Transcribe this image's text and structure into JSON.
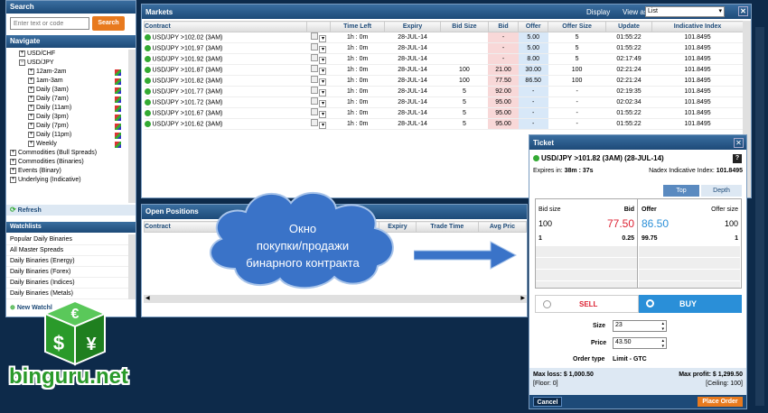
{
  "left": {
    "search_title": "Search",
    "search_placeholder": "Enter text or code",
    "search_button": "Search",
    "navigate_title": "Navigate",
    "tree": [
      {
        "label": "USD/CHF",
        "level": 1,
        "toggle": "+"
      },
      {
        "label": "USD/JPY",
        "level": 1,
        "toggle": "−"
      },
      {
        "label": "12am-2am",
        "level": 2,
        "toggle": "+"
      },
      {
        "label": "1am-3am",
        "level": 2,
        "toggle": "+"
      },
      {
        "label": "Daily (3am)",
        "level": 2,
        "toggle": "+"
      },
      {
        "label": "Daily (7am)",
        "level": 2,
        "toggle": "+"
      },
      {
        "label": "Daily (11am)",
        "level": 2,
        "toggle": "+"
      },
      {
        "label": "Daily (3pm)",
        "level": 2,
        "toggle": "+"
      },
      {
        "label": "Daily (7pm)",
        "level": 2,
        "toggle": "+"
      },
      {
        "label": "Daily (11pm)",
        "level": 2,
        "toggle": "+"
      },
      {
        "label": "Weekly",
        "level": 2,
        "toggle": "+"
      },
      {
        "label": "Commodities (Bull Spreads)",
        "level": 0,
        "toggle": "+"
      },
      {
        "label": "Commodities (Binaries)",
        "level": 0,
        "toggle": "+"
      },
      {
        "label": "Events (Binary)",
        "level": 0,
        "toggle": "+"
      },
      {
        "label": "Underlying (Indicative)",
        "level": 0,
        "toggle": "+"
      }
    ],
    "refresh": "Refresh",
    "watchlists_title": "Watchlists",
    "watchlists": [
      "Popular Daily Binaries",
      "All Master Spreads",
      "Daily Binaries (Energy)",
      "Daily Binaries (Forex)",
      "Daily Binaries (Indices)",
      "Daily Binaries (Metals)"
    ],
    "new_watchlist": "New Watchl"
  },
  "markets": {
    "title": "Markets",
    "display": "Display",
    "view_as": "View as",
    "view_value": "List",
    "columns": [
      "Contract",
      "Time Left",
      "Expiry",
      "Bid Size",
      "Bid",
      "Offer",
      "Offer Size",
      "Update",
      "Indicative Index"
    ],
    "rows": [
      [
        "USD/JPY >102.02 (3AM)",
        "1h : 0m",
        "28-JUL-14",
        "",
        "-",
        "5.00",
        "5",
        "01:55:22",
        "101.8495"
      ],
      [
        "USD/JPY >101.97 (3AM)",
        "1h : 0m",
        "28-JUL-14",
        "",
        "-",
        "5.00",
        "5",
        "01:55:22",
        "101.8495"
      ],
      [
        "USD/JPY >101.92 (3AM)",
        "1h : 0m",
        "28-JUL-14",
        "",
        "-",
        "8.00",
        "5",
        "02:17:49",
        "101.8495"
      ],
      [
        "USD/JPY >101.87 (3AM)",
        "1h : 0m",
        "28-JUL-14",
        "100",
        "21.00",
        "30.00",
        "100",
        "02:21:24",
        "101.8495"
      ],
      [
        "USD/JPY >101.82 (3AM)",
        "1h : 0m",
        "28-JUL-14",
        "100",
        "77.50",
        "86.50",
        "100",
        "02:21:24",
        "101.8495"
      ],
      [
        "USD/JPY >101.77 (3AM)",
        "1h : 0m",
        "28-JUL-14",
        "5",
        "92.00",
        "-",
        "-",
        "02:19:35",
        "101.8495"
      ],
      [
        "USD/JPY >101.72 (3AM)",
        "1h : 0m",
        "28-JUL-14",
        "5",
        "95.00",
        "-",
        "-",
        "02:02:34",
        "101.8495"
      ],
      [
        "USD/JPY >101.67 (3AM)",
        "1h : 0m",
        "28-JUL-14",
        "5",
        "95.00",
        "-",
        "-",
        "01:55:22",
        "101.8495"
      ],
      [
        "USD/JPY >101.62 (3AM)",
        "1h : 0m",
        "28-JUL-14",
        "5",
        "95.00",
        "-",
        "-",
        "01:55:22",
        "101.8495"
      ]
    ]
  },
  "open_positions": {
    "title": "Open Positions",
    "columns": [
      "Contract",
      "Expiry",
      "Trade Time",
      "Avg Pric"
    ]
  },
  "ticket": {
    "title": "Ticket",
    "contract": "USD/JPY >101.82 (3AM) (28-JUL-14)",
    "expires_label": "Expires in:",
    "expires_value": "38m : 37s",
    "nadex_label": "Nadex Indicative Index:",
    "nadex_value": "101.8495",
    "tab_top": "Top",
    "tab_depth": "Depth",
    "bid_size_h": "Bid size",
    "bid_h": "Bid",
    "offer_h": "Offer",
    "offer_size_h": "Offer size",
    "depth_rows": [
      [
        "100",
        "77.50",
        "86.50",
        "100"
      ],
      [
        "1",
        "0.25",
        "99.75",
        "1"
      ]
    ],
    "sell": "SELL",
    "buy": "BUY",
    "size_label": "Size",
    "size_value": "23",
    "price_label": "Price",
    "price_value": "43.50",
    "order_type_label": "Order type",
    "order_type_value": "Limit - GTC",
    "max_loss": "Max loss:  $ 1,000.50",
    "floor": "[Floor: 0]",
    "max_profit": "Max profit:  $ 1,299.50",
    "ceiling": "[Ceiling: 100]",
    "cancel": "Cancel",
    "place_order": "Place Order",
    "help": "?"
  },
  "annotation": {
    "line1": "Окно",
    "line2": "покупки/продажи",
    "line3": "бинарного контракта"
  },
  "logo": {
    "text": "binguru.net",
    "symbols": [
      "€",
      "$",
      "¥"
    ]
  },
  "colors": {
    "accent_orange": "#e87a1e",
    "buy_blue": "#2a8fd8",
    "sell_red": "#d23",
    "bid_bg": "#f8d8d8",
    "offer_bg": "#d8e8f8",
    "cloud": "#3a73c8",
    "header_blue": "#1d4a78",
    "logo_green": "#2a9a2a"
  }
}
